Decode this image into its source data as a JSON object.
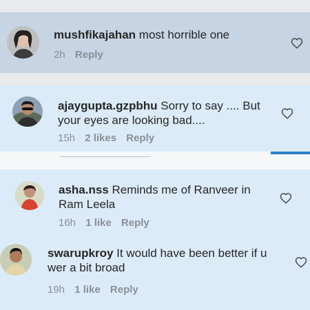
{
  "comments": [
    {
      "username": "mushfikajahan",
      "text": "most horrible one",
      "time": "2h",
      "likes": "",
      "reply": "Reply",
      "avatar": "avatar-woman"
    },
    {
      "username": "ajaygupta.gzpbhu",
      "text": "Sorry to say .... But your eyes are looking bad....",
      "time": "15h",
      "likes": "2 likes",
      "reply": "Reply",
      "avatar": "avatar-man-sunglasses"
    },
    {
      "username": "asha.nss",
      "text": "Reminds me of Ranveer in Ram Leela",
      "time": "16h",
      "likes": "1 like",
      "reply": "Reply",
      "avatar": "avatar-woman-red"
    },
    {
      "username": "swarupkroy",
      "text": "It would have been better if u wer a bit broad",
      "time": "19h",
      "likes": "1 like",
      "reply": "Reply",
      "avatar": "avatar-man"
    }
  ],
  "icons": {
    "like": "heart-outline-icon"
  },
  "colors": {
    "panel_top": "#c6d4e3",
    "panel_bottom": "#dcebf9",
    "divider_accent": "#2f80c8",
    "meta_text": "#8a8f96"
  }
}
